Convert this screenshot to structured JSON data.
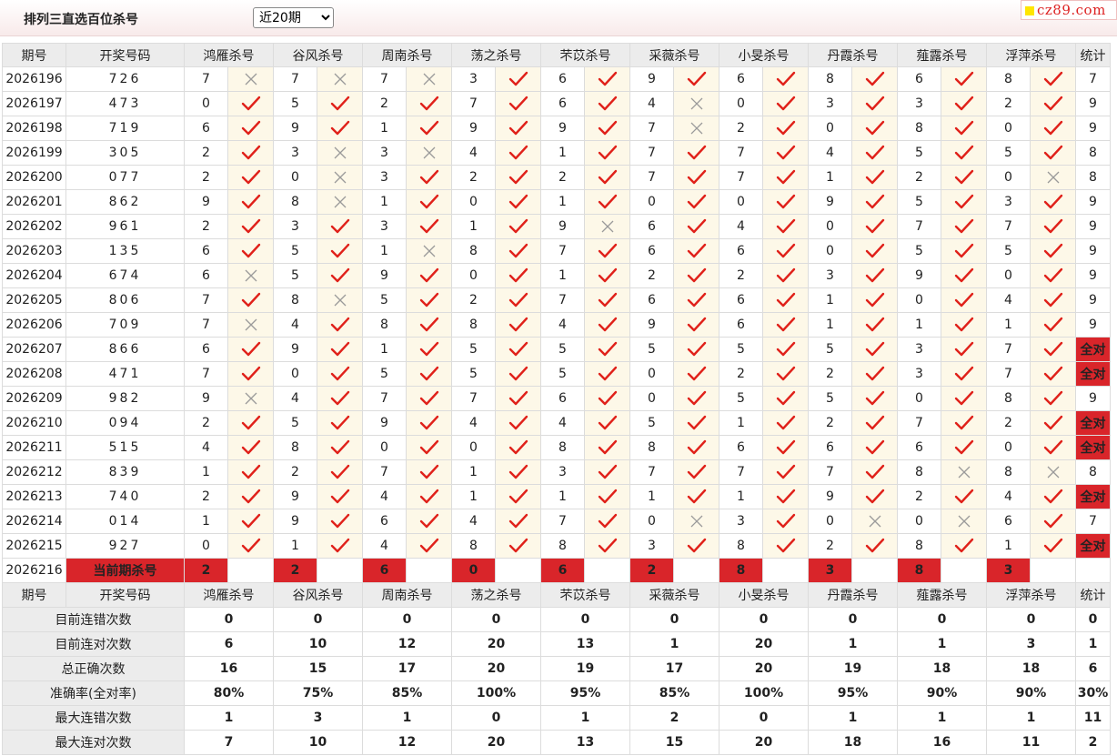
{
  "header": {
    "title": "排列三直选百位杀号",
    "period_select": {
      "selected": "近20期",
      "options": [
        "近20期"
      ]
    },
    "logo_text": "cz89.com"
  },
  "columns": {
    "period": "期号",
    "draw": "开奖号码",
    "experts": [
      "鸿雁杀号",
      "谷风杀号",
      "周南杀号",
      "荡之杀号",
      "芣苡杀号",
      "采薇杀号",
      "小旻杀号",
      "丹霞杀号",
      "薤露杀号",
      "浮萍杀号"
    ],
    "stat": "统计"
  },
  "rows": [
    {
      "period": "2026196",
      "draw": "726",
      "kills": [
        [
          "7",
          "x"
        ],
        [
          "7",
          "x"
        ],
        [
          "7",
          "x"
        ],
        [
          "3",
          "c"
        ],
        [
          "6",
          "c"
        ],
        [
          "9",
          "c"
        ],
        [
          "6",
          "c"
        ],
        [
          "8",
          "c"
        ],
        [
          "6",
          "c"
        ],
        [
          "8",
          "c"
        ]
      ],
      "stat": "7"
    },
    {
      "period": "2026197",
      "draw": "473",
      "kills": [
        [
          "0",
          "c"
        ],
        [
          "5",
          "c"
        ],
        [
          "2",
          "c"
        ],
        [
          "7",
          "c"
        ],
        [
          "6",
          "c"
        ],
        [
          "4",
          "x"
        ],
        [
          "0",
          "c"
        ],
        [
          "3",
          "c"
        ],
        [
          "3",
          "c"
        ],
        [
          "2",
          "c"
        ]
      ],
      "stat": "9"
    },
    {
      "period": "2026198",
      "draw": "719",
      "kills": [
        [
          "6",
          "c"
        ],
        [
          "9",
          "c"
        ],
        [
          "1",
          "c"
        ],
        [
          "9",
          "c"
        ],
        [
          "9",
          "c"
        ],
        [
          "7",
          "x"
        ],
        [
          "2",
          "c"
        ],
        [
          "0",
          "c"
        ],
        [
          "8",
          "c"
        ],
        [
          "0",
          "c"
        ]
      ],
      "stat": "9"
    },
    {
      "period": "2026199",
      "draw": "305",
      "kills": [
        [
          "2",
          "c"
        ],
        [
          "3",
          "x"
        ],
        [
          "3",
          "x"
        ],
        [
          "4",
          "c"
        ],
        [
          "1",
          "c"
        ],
        [
          "7",
          "c"
        ],
        [
          "7",
          "c"
        ],
        [
          "4",
          "c"
        ],
        [
          "5",
          "c"
        ],
        [
          "5",
          "c"
        ]
      ],
      "stat": "8"
    },
    {
      "period": "2026200",
      "draw": "077",
      "kills": [
        [
          "2",
          "c"
        ],
        [
          "0",
          "x"
        ],
        [
          "3",
          "c"
        ],
        [
          "2",
          "c"
        ],
        [
          "2",
          "c"
        ],
        [
          "7",
          "c"
        ],
        [
          "7",
          "c"
        ],
        [
          "1",
          "c"
        ],
        [
          "2",
          "c"
        ],
        [
          "0",
          "x"
        ]
      ],
      "stat": "8"
    },
    {
      "period": "2026201",
      "draw": "862",
      "kills": [
        [
          "9",
          "c"
        ],
        [
          "8",
          "x"
        ],
        [
          "1",
          "c"
        ],
        [
          "0",
          "c"
        ],
        [
          "1",
          "c"
        ],
        [
          "0",
          "c"
        ],
        [
          "0",
          "c"
        ],
        [
          "9",
          "c"
        ],
        [
          "5",
          "c"
        ],
        [
          "3",
          "c"
        ]
      ],
      "stat": "9"
    },
    {
      "period": "2026202",
      "draw": "961",
      "kills": [
        [
          "2",
          "c"
        ],
        [
          "3",
          "c"
        ],
        [
          "3",
          "c"
        ],
        [
          "1",
          "c"
        ],
        [
          "9",
          "x"
        ],
        [
          "6",
          "c"
        ],
        [
          "4",
          "c"
        ],
        [
          "0",
          "c"
        ],
        [
          "7",
          "c"
        ],
        [
          "7",
          "c"
        ]
      ],
      "stat": "9"
    },
    {
      "period": "2026203",
      "draw": "135",
      "kills": [
        [
          "6",
          "c"
        ],
        [
          "5",
          "c"
        ],
        [
          "1",
          "x"
        ],
        [
          "8",
          "c"
        ],
        [
          "7",
          "c"
        ],
        [
          "6",
          "c"
        ],
        [
          "6",
          "c"
        ],
        [
          "0",
          "c"
        ],
        [
          "5",
          "c"
        ],
        [
          "5",
          "c"
        ]
      ],
      "stat": "9"
    },
    {
      "period": "2026204",
      "draw": "674",
      "kills": [
        [
          "6",
          "x"
        ],
        [
          "5",
          "c"
        ],
        [
          "9",
          "c"
        ],
        [
          "0",
          "c"
        ],
        [
          "1",
          "c"
        ],
        [
          "2",
          "c"
        ],
        [
          "2",
          "c"
        ],
        [
          "3",
          "c"
        ],
        [
          "9",
          "c"
        ],
        [
          "0",
          "c"
        ]
      ],
      "stat": "9"
    },
    {
      "period": "2026205",
      "draw": "806",
      "kills": [
        [
          "7",
          "c"
        ],
        [
          "8",
          "x"
        ],
        [
          "5",
          "c"
        ],
        [
          "2",
          "c"
        ],
        [
          "7",
          "c"
        ],
        [
          "6",
          "c"
        ],
        [
          "6",
          "c"
        ],
        [
          "1",
          "c"
        ],
        [
          "0",
          "c"
        ],
        [
          "4",
          "c"
        ]
      ],
      "stat": "9"
    },
    {
      "period": "2026206",
      "draw": "709",
      "kills": [
        [
          "7",
          "x"
        ],
        [
          "4",
          "c"
        ],
        [
          "8",
          "c"
        ],
        [
          "8",
          "c"
        ],
        [
          "4",
          "c"
        ],
        [
          "9",
          "c"
        ],
        [
          "6",
          "c"
        ],
        [
          "1",
          "c"
        ],
        [
          "1",
          "c"
        ],
        [
          "1",
          "c"
        ]
      ],
      "stat": "9"
    },
    {
      "period": "2026207",
      "draw": "866",
      "kills": [
        [
          "6",
          "c"
        ],
        [
          "9",
          "c"
        ],
        [
          "1",
          "c"
        ],
        [
          "5",
          "c"
        ],
        [
          "5",
          "c"
        ],
        [
          "5",
          "c"
        ],
        [
          "5",
          "c"
        ],
        [
          "5",
          "c"
        ],
        [
          "3",
          "c"
        ],
        [
          "7",
          "c"
        ]
      ],
      "stat": "全对"
    },
    {
      "period": "2026208",
      "draw": "471",
      "kills": [
        [
          "7",
          "c"
        ],
        [
          "0",
          "c"
        ],
        [
          "5",
          "c"
        ],
        [
          "5",
          "c"
        ],
        [
          "5",
          "c"
        ],
        [
          "0",
          "c"
        ],
        [
          "2",
          "c"
        ],
        [
          "2",
          "c"
        ],
        [
          "3",
          "c"
        ],
        [
          "7",
          "c"
        ]
      ],
      "stat": "全对"
    },
    {
      "period": "2026209",
      "draw": "982",
      "kills": [
        [
          "9",
          "x"
        ],
        [
          "4",
          "c"
        ],
        [
          "7",
          "c"
        ],
        [
          "7",
          "c"
        ],
        [
          "6",
          "c"
        ],
        [
          "0",
          "c"
        ],
        [
          "5",
          "c"
        ],
        [
          "5",
          "c"
        ],
        [
          "0",
          "c"
        ],
        [
          "8",
          "c"
        ]
      ],
      "stat": "9"
    },
    {
      "period": "2026210",
      "draw": "094",
      "kills": [
        [
          "2",
          "c"
        ],
        [
          "5",
          "c"
        ],
        [
          "9",
          "c"
        ],
        [
          "4",
          "c"
        ],
        [
          "4",
          "c"
        ],
        [
          "5",
          "c"
        ],
        [
          "1",
          "c"
        ],
        [
          "2",
          "c"
        ],
        [
          "7",
          "c"
        ],
        [
          "2",
          "c"
        ]
      ],
      "stat": "全对"
    },
    {
      "period": "2026211",
      "draw": "515",
      "kills": [
        [
          "4",
          "c"
        ],
        [
          "8",
          "c"
        ],
        [
          "0",
          "c"
        ],
        [
          "0",
          "c"
        ],
        [
          "8",
          "c"
        ],
        [
          "8",
          "c"
        ],
        [
          "6",
          "c"
        ],
        [
          "6",
          "c"
        ],
        [
          "6",
          "c"
        ],
        [
          "0",
          "c"
        ]
      ],
      "stat": "全对"
    },
    {
      "period": "2026212",
      "draw": "839",
      "kills": [
        [
          "1",
          "c"
        ],
        [
          "2",
          "c"
        ],
        [
          "7",
          "c"
        ],
        [
          "1",
          "c"
        ],
        [
          "3",
          "c"
        ],
        [
          "7",
          "c"
        ],
        [
          "7",
          "c"
        ],
        [
          "7",
          "c"
        ],
        [
          "8",
          "x"
        ],
        [
          "8",
          "x"
        ]
      ],
      "stat": "8"
    },
    {
      "period": "2026213",
      "draw": "740",
      "kills": [
        [
          "2",
          "c"
        ],
        [
          "9",
          "c"
        ],
        [
          "4",
          "c"
        ],
        [
          "1",
          "c"
        ],
        [
          "1",
          "c"
        ],
        [
          "1",
          "c"
        ],
        [
          "1",
          "c"
        ],
        [
          "9",
          "c"
        ],
        [
          "2",
          "c"
        ],
        [
          "4",
          "c"
        ]
      ],
      "stat": "全对"
    },
    {
      "period": "2026214",
      "draw": "014",
      "kills": [
        [
          "1",
          "c"
        ],
        [
          "9",
          "c"
        ],
        [
          "6",
          "c"
        ],
        [
          "4",
          "c"
        ],
        [
          "7",
          "c"
        ],
        [
          "0",
          "x"
        ],
        [
          "3",
          "c"
        ],
        [
          "0",
          "x"
        ],
        [
          "0",
          "x"
        ],
        [
          "6",
          "c"
        ]
      ],
      "stat": "7"
    },
    {
      "period": "2026215",
      "draw": "927",
      "kills": [
        [
          "0",
          "c"
        ],
        [
          "1",
          "c"
        ],
        [
          "4",
          "c"
        ],
        [
          "8",
          "c"
        ],
        [
          "8",
          "c"
        ],
        [
          "3",
          "c"
        ],
        [
          "8",
          "c"
        ],
        [
          "2",
          "c"
        ],
        [
          "8",
          "c"
        ],
        [
          "1",
          "c"
        ]
      ],
      "stat": "全对"
    }
  ],
  "current": {
    "period": "2026216",
    "label": "当前期杀号",
    "kills": [
      "2",
      "2",
      "6",
      "0",
      "6",
      "2",
      "8",
      "3",
      "8",
      "3"
    ]
  },
  "summary": [
    {
      "label": "目前连错次数",
      "values": [
        "0",
        "0",
        "0",
        "0",
        "0",
        "0",
        "0",
        "0",
        "0",
        "0"
      ],
      "stat": "0",
      "color": "blue"
    },
    {
      "label": "目前连对次数",
      "values": [
        "6",
        "10",
        "12",
        "20",
        "13",
        "1",
        "20",
        "1",
        "1",
        "3"
      ],
      "stat": "1",
      "color": "blue"
    },
    {
      "label": "总正确次数",
      "values": [
        "16",
        "15",
        "17",
        "20",
        "19",
        "17",
        "20",
        "19",
        "18",
        "18"
      ],
      "stat": "6",
      "color": "blue"
    },
    {
      "label": "准确率(全对率)",
      "values": [
        "80%",
        "75%",
        "85%",
        "100%",
        "95%",
        "85%",
        "100%",
        "95%",
        "90%",
        "90%"
      ],
      "stat": "30%",
      "color": "red"
    },
    {
      "label": "最大连错次数",
      "values": [
        "1",
        "3",
        "1",
        "0",
        "1",
        "2",
        "0",
        "1",
        "1",
        "1"
      ],
      "stat": "11",
      "color": "blue"
    },
    {
      "label": "最大连对次数",
      "values": [
        "7",
        "10",
        "12",
        "20",
        "13",
        "15",
        "20",
        "18",
        "16",
        "11"
      ],
      "stat": "2",
      "color": "blue"
    }
  ],
  "colors": {
    "accent": "#d9252a",
    "check": "#e0211a",
    "cross": "#9a9a9a",
    "header_bg": "#ececec",
    "mark_bg": "#fdf8e8",
    "stat_blue": "#1a3fc4"
  }
}
